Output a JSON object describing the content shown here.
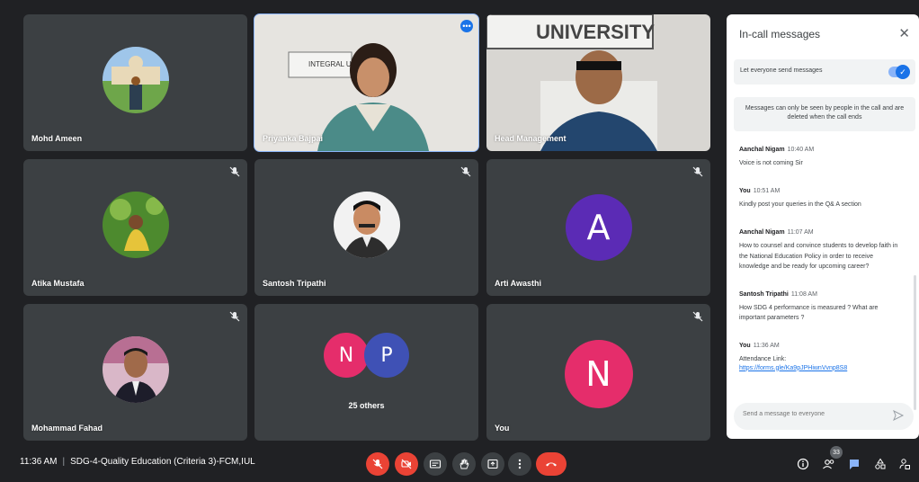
{
  "participants": [
    {
      "name": "Mohd Ameen"
    },
    {
      "name": "Priyanka Bajpai"
    },
    {
      "name": "Head Management"
    },
    {
      "name": "Atika Mustafa"
    },
    {
      "name": "Santosh Tripathi"
    },
    {
      "name": "Arti Awasthi",
      "initial": "A",
      "color": "#5b2bb5"
    },
    {
      "name": "Mohammad Fahad"
    },
    {
      "name": "25 others",
      "initials": [
        "N",
        "P"
      ],
      "colors": [
        "#e52d6b",
        "#3f51b5"
      ]
    },
    {
      "name": "You",
      "initial": "N",
      "color": "#e52d6b"
    }
  ],
  "chat": {
    "title": "In-call messages",
    "toggle_label": "Let everyone send messages",
    "notice": "Messages can only be seen by people in the call and are deleted when the call ends",
    "messages": [
      {
        "sender": "Aanchal Nigam",
        "time": "10:40 AM",
        "text": "Voice is not coming Sir"
      },
      {
        "sender": "You",
        "time": "10:51 AM",
        "text": "Kindly post your queries in the Q& A section"
      },
      {
        "sender": "Aanchal Nigam",
        "time": "11:07 AM",
        "text": "How to counsel and convince students to develop faith in the National Education Policy in order to receive knowledge and be ready for upcoming career?"
      },
      {
        "sender": "Santosh Tripathi",
        "time": "11:08 AM",
        "text": "How SDG 4 performance is measured ? What are important parameters ?"
      },
      {
        "sender": "You",
        "time": "11:36 AM",
        "text": "Attendance Link:",
        "link": "https://forms.gle/Ka9pJPHiwnVvnp8S8"
      }
    ],
    "input_placeholder": "Send a message to everyone"
  },
  "bar": {
    "time": "11:36 AM",
    "separator": "|",
    "meeting_title": "SDG-4-Quality Education (Criteria 3)-FCM,IUL",
    "participant_count": "33"
  },
  "video_text": {
    "tile2_sign": "INTEGRAL UNIVERSITY",
    "tile3_sign": "UNIVERSITY"
  },
  "colors": {
    "accent": "#1a73e8",
    "danger": "#ea4335",
    "tile": "#3c4043",
    "background": "#202124"
  }
}
